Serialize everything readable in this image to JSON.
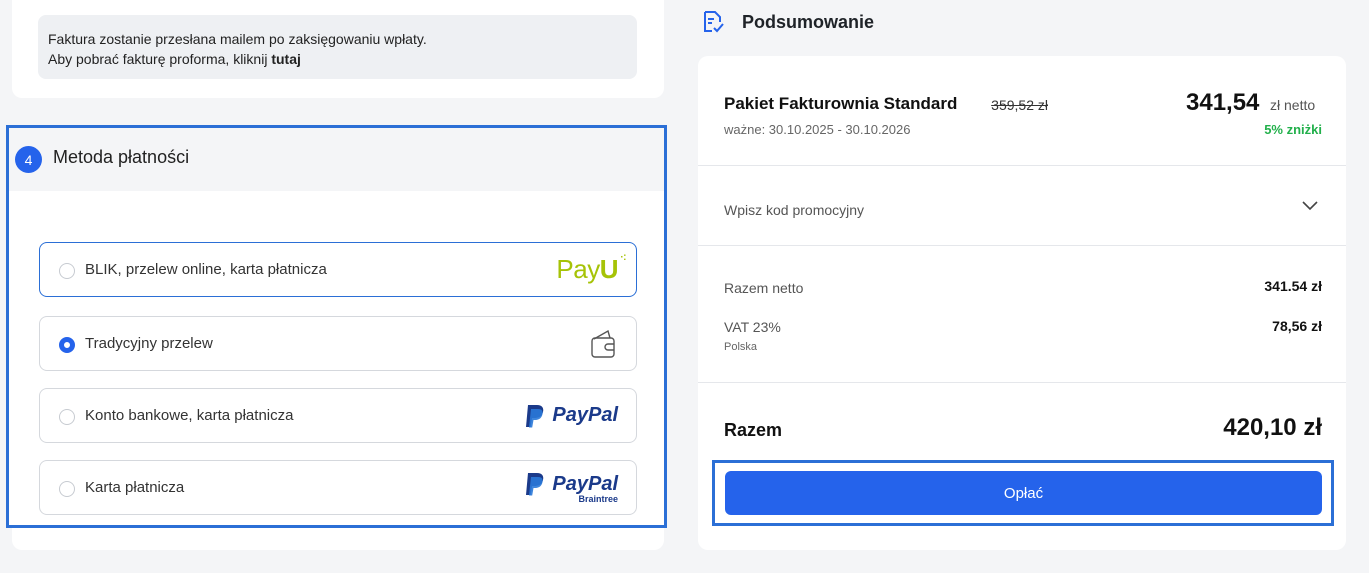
{
  "invoice_info": {
    "line1": "Faktura zostanie przesłana mailem po zaksięgowaniu wpłaty.",
    "line2_prefix": "Aby pobrać fakturę proforma, kliknij ",
    "line2_link": "tutaj"
  },
  "payment_method": {
    "step_number": "4",
    "title": "Metoda płatności",
    "options": [
      {
        "label": "BLIK, przelew online, karta płatnicza",
        "logo": "PayU",
        "selected": false
      },
      {
        "label": "Tradycyjny przelew",
        "logo": "wallet-icon",
        "selected": true
      },
      {
        "label": "Konto bankowe, karta płatnicza",
        "logo": "PayPal",
        "selected": false
      },
      {
        "label": "Karta płatnicza",
        "logo": "PayPal Braintree",
        "selected": false
      }
    ],
    "payu_text": "Pay",
    "payu_u": "U",
    "paypal_text": "PayPal",
    "braintree_text": "Braintree"
  },
  "summary": {
    "title": "Podsumowanie",
    "package_name": "Pakiet Fakturownia Standard",
    "valid": "ważne: 30.10.2025 - 30.10.2026",
    "old_price": "359,52 zł",
    "new_price": "341,54",
    "netto_label": "zł netto",
    "discount": "5% zniżki",
    "promo_placeholder": "Wpisz kod promocyjny",
    "net_total_label": "Razem netto",
    "net_total_value": "341.54 zł",
    "vat_label": "VAT 23%",
    "vat_value": "78,56 zł",
    "country": "Polska",
    "total_label": "Razem",
    "total_value": "420,10 zł",
    "pay_button": "Opłać"
  },
  "colors": {
    "accent": "#2563eb",
    "highlight_border": "#2b6fd6",
    "discount_green": "#22b04b",
    "payu_green": "#a6c307",
    "paypal_navy": "#1b3a8a"
  }
}
